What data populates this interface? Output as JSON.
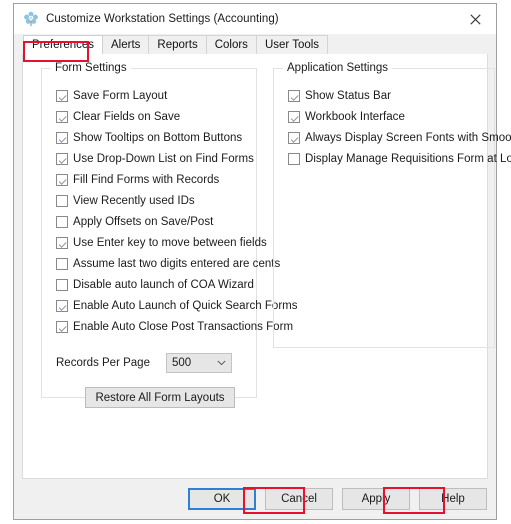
{
  "window": {
    "title": "Customize Workstation Settings (Accounting)",
    "icon": "settings-flower-icon",
    "close_label": "✕"
  },
  "tabs": [
    {
      "label": "Preferences",
      "active": true
    },
    {
      "label": "Alerts",
      "active": false
    },
    {
      "label": "Reports",
      "active": false
    },
    {
      "label": "Colors",
      "active": false
    },
    {
      "label": "User Tools",
      "active": false
    }
  ],
  "form_settings": {
    "title": "Form Settings",
    "checkboxes": [
      {
        "label": "Save Form Layout",
        "checked": true
      },
      {
        "label": "Clear Fields on Save",
        "checked": true
      },
      {
        "label": "Show Tooltips on Bottom Buttons",
        "checked": true
      },
      {
        "label": "Use Drop-Down List on Find Forms",
        "checked": true
      },
      {
        "label": "Fill Find Forms with Records",
        "checked": true
      },
      {
        "label": "View Recently used IDs",
        "checked": false
      },
      {
        "label": "Apply Offsets on Save/Post",
        "checked": false
      },
      {
        "label": "Use Enter key to move between fields",
        "checked": true
      },
      {
        "label": "Assume last two digits entered are cents",
        "checked": false
      },
      {
        "label": "Disable auto launch of COA Wizard",
        "checked": false
      },
      {
        "label": "Enable Auto Launch of Quick Search Forms",
        "checked": true
      },
      {
        "label": "Enable Auto Close Post Transactions Form",
        "checked": true
      }
    ],
    "records_per_page": {
      "label": "Records Per Page",
      "value": "500"
    },
    "restore_button": "Restore All Form Layouts"
  },
  "application_settings": {
    "title": "Application Settings",
    "checkboxes": [
      {
        "label": "Show Status Bar",
        "checked": true
      },
      {
        "label": "Workbook Interface",
        "checked": true
      },
      {
        "label": "Always Display Screen Fonts with Smooth Edges",
        "checked": true
      },
      {
        "label": "Display Manage Requisitions Form at Log On",
        "checked": false
      }
    ]
  },
  "footer": {
    "ok": "OK",
    "cancel": "Cancel",
    "apply": "Apply",
    "help": "Help"
  },
  "annotations": {
    "color": "#e8112d",
    "targets": [
      "Preferences tab",
      "OK button",
      "Apply button"
    ]
  }
}
